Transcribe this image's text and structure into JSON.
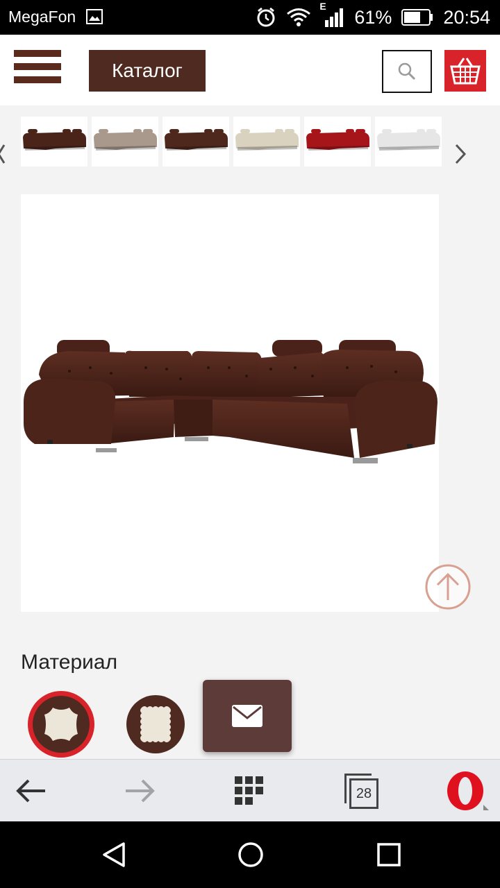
{
  "status_bar": {
    "carrier": "MegaFon",
    "network": "E",
    "battery": "61%",
    "time": "20:54",
    "icons": [
      "gallery-icon",
      "alarm-icon",
      "wifi-icon",
      "signal-icon",
      "battery-icon"
    ]
  },
  "header": {
    "menu_icon": "hamburger-icon",
    "catalog_label": "Каталог",
    "search_icon": "search-icon",
    "cart_icon": "basket-icon",
    "brand_color": "#4f2a20",
    "cart_color": "#d8232a"
  },
  "gallery": {
    "thumbnails": [
      {
        "name": "sofa-thumb-dark-brown",
        "color": "#4a2418"
      },
      {
        "name": "sofa-thumb-beige",
        "color": "#a8998c"
      },
      {
        "name": "sofa-thumb-brown",
        "color": "#4e281c"
      },
      {
        "name": "sofa-thumb-cream",
        "color": "#d9d2bf"
      },
      {
        "name": "sofa-thumb-red",
        "color": "#a5151a"
      },
      {
        "name": "sofa-thumb-white",
        "color": "#e6e6e6"
      }
    ],
    "prev_icon": "chevron-left-icon",
    "next_icon": "chevron-right-icon"
  },
  "main_image": {
    "name": "corner-sofa-brown",
    "color": "#4a2219"
  },
  "scroll_top_icon": "arrow-up-circle-icon",
  "material": {
    "title": "Материал",
    "options": [
      {
        "name": "leather-hide-icon",
        "selected": true
      },
      {
        "name": "fabric-swatch-icon",
        "selected": false
      }
    ]
  },
  "contact_icon": "mail-icon",
  "browser_bar": {
    "back_icon": "back-arrow-icon",
    "forward_icon": "forward-arrow-icon",
    "speed_dial_icon": "grid-icon",
    "tabs_count": "28",
    "opera_icon": "opera-logo-icon"
  },
  "system_nav": {
    "icons": [
      "back-triangle-icon",
      "home-circle-icon",
      "recents-square-icon"
    ]
  }
}
